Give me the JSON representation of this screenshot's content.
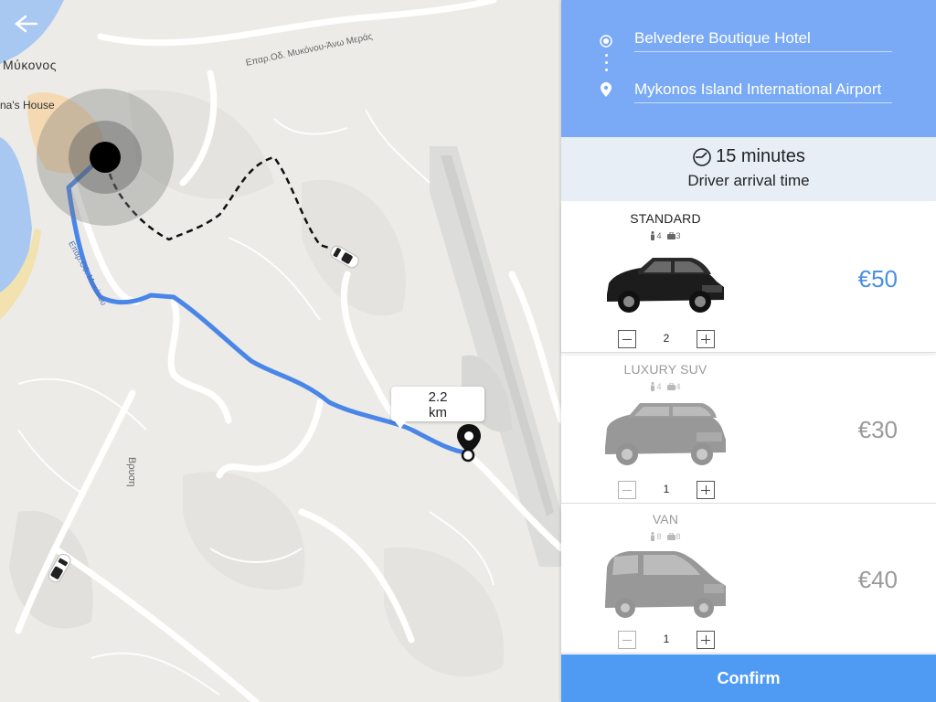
{
  "map": {
    "town_label": "Μύκονος",
    "place_label": "na's House",
    "road_label_1": "Επαρ.Οδ. Μυκόνου-Άνω Μεράς",
    "road_label_2": "Επαρ.Οδ. Μυκόνου",
    "road_label_3": "Βρυση",
    "distance_value": "2.2",
    "distance_unit": "km",
    "route_color": "#4a86e8"
  },
  "trip": {
    "origin": "Belvedere Boutique Hotel",
    "destination": "Mykonos Island International Airport"
  },
  "eta": {
    "value": "15 minutes",
    "label": "Driver arrival time"
  },
  "cars": [
    {
      "name": "STANDARD",
      "passengers": "4",
      "luggage": "3",
      "price": "€50",
      "quantity": "2",
      "selected": true
    },
    {
      "name": "LUXURY SUV",
      "passengers": "4",
      "luggage": "4",
      "price": "€30",
      "quantity": "1",
      "selected": false
    },
    {
      "name": "VAN",
      "passengers": "8",
      "luggage": "8",
      "price": "€40",
      "quantity": "1",
      "selected": false
    }
  ],
  "confirm_label": "Confirm",
  "colors": {
    "header": "#7aaaf5",
    "accent": "#4a90e2",
    "confirm": "#4f9bf4",
    "eta_bg": "#e8eef6"
  }
}
